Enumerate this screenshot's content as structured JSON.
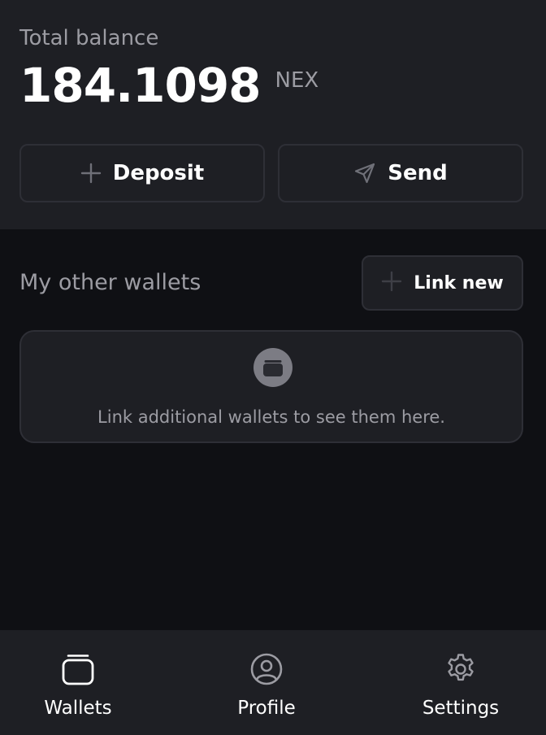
{
  "balance": {
    "label": "Total balance",
    "amount": "184.1098",
    "currency": "NEX"
  },
  "actions": {
    "deposit_label": "Deposit",
    "send_label": "Send"
  },
  "other_wallets": {
    "title": "My other wallets",
    "link_new_label": "Link new",
    "empty_message": "Link additional wallets to see them here."
  },
  "nav": {
    "items": [
      {
        "label": "Wallets",
        "icon": "wallets-icon"
      },
      {
        "label": "Profile",
        "icon": "profile-icon"
      },
      {
        "label": "Settings",
        "icon": "settings-icon"
      }
    ]
  },
  "colors": {
    "background": "#0f1014",
    "surface": "#1e1f24",
    "border": "#2e2f36",
    "muted_text": "#9c9ca3",
    "text": "#ffffff"
  }
}
